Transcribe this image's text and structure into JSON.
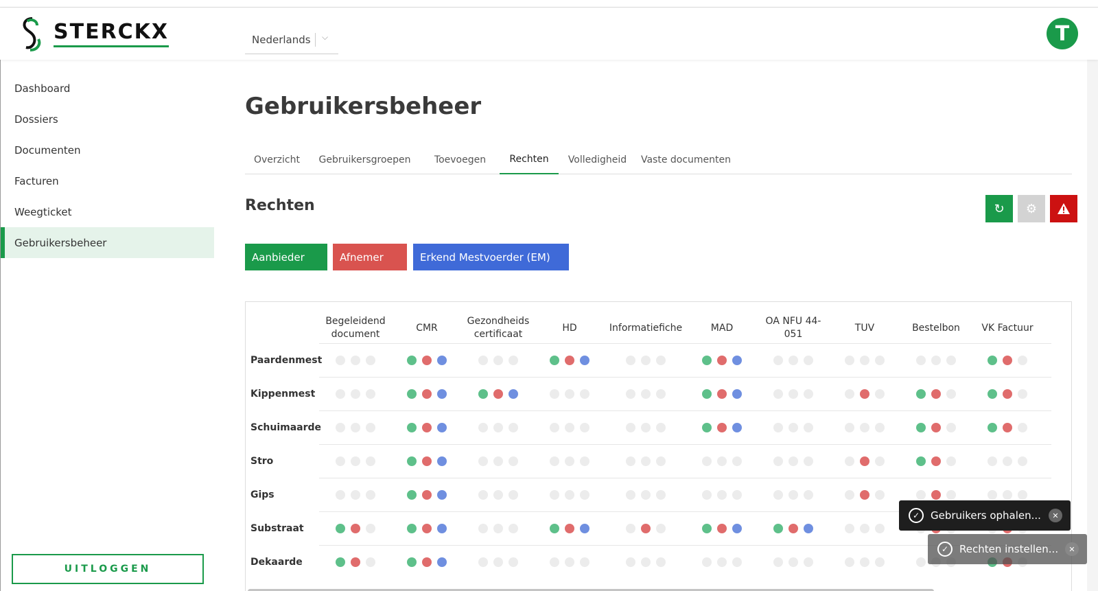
{
  "app": {
    "logo_text": "STERCKX",
    "language": "Nederlands",
    "avatar_letter": "T"
  },
  "sidebar": {
    "items": [
      {
        "label": "Dashboard"
      },
      {
        "label": "Dossiers"
      },
      {
        "label": "Documenten"
      },
      {
        "label": "Facturen"
      },
      {
        "label": "Weegticket"
      },
      {
        "label": "Gebruikersbeheer",
        "active": true
      }
    ],
    "logout_label": "UITLOGGEN"
  },
  "page": {
    "title": "Gebruikersbeheer"
  },
  "tabs": [
    {
      "label": "Overzicht"
    },
    {
      "label": "Gebruikersgroepen"
    },
    {
      "label": "Toevoegen"
    },
    {
      "label": "Rechten",
      "active": true
    },
    {
      "label": "Volledigheid"
    },
    {
      "label": "Vaste documenten"
    }
  ],
  "section": {
    "title": "Rechten"
  },
  "toolbar": {
    "refresh_icon": "refresh-icon",
    "settings_icon": "gear-icon",
    "warning_icon": "warning-icon"
  },
  "roles": [
    {
      "label": "Aanbieder",
      "color": "#1a9a4a"
    },
    {
      "label": "Afnemer",
      "color": "#d9534f"
    },
    {
      "label": "Erkend Mestvoerder (EM)",
      "color": "#3f6ad8"
    }
  ],
  "colors": {
    "green": "#5ec08a",
    "red": "#e06c6c",
    "blue": "#6f8fe0",
    "off": "#ececec",
    "accent": "#1a9a4a"
  },
  "table": {
    "columns": [
      {
        "line1": "Begeleidend",
        "line2": "document"
      },
      {
        "line1": "CMR",
        "line2": ""
      },
      {
        "line1": "Gezondheids",
        "line2": "certificaat"
      },
      {
        "line1": "HD",
        "line2": ""
      },
      {
        "line1": "Informatiefiche",
        "line2": ""
      },
      {
        "line1": "MAD",
        "line2": ""
      },
      {
        "line1": "OA NFU 44-",
        "line2": "051"
      },
      {
        "line1": "TUV",
        "line2": ""
      },
      {
        "line1": "Bestelbon",
        "line2": ""
      },
      {
        "line1": "VK Factuur",
        "line2": ""
      }
    ],
    "rows": [
      {
        "label": "Paardenmest",
        "cells": [
          "000",
          "111",
          "000",
          "111",
          "000",
          "111",
          "000",
          "000",
          "000",
          "110"
        ]
      },
      {
        "label": "Kippenmest",
        "cells": [
          "000",
          "111",
          "111",
          "000",
          "000",
          "111",
          "000",
          "010",
          "110",
          "110"
        ]
      },
      {
        "label": "Schuimaarde",
        "cells": [
          "000",
          "111",
          "000",
          "000",
          "000",
          "111",
          "000",
          "000",
          "110",
          "110"
        ]
      },
      {
        "label": "Stro",
        "cells": [
          "000",
          "111",
          "000",
          "000",
          "000",
          "000",
          "000",
          "010",
          "110",
          "000"
        ]
      },
      {
        "label": "Gips",
        "cells": [
          "000",
          "111",
          "000",
          "000",
          "000",
          "000",
          "000",
          "010",
          "010",
          "000"
        ]
      },
      {
        "label": "Substraat",
        "cells": [
          "110",
          "111",
          "000",
          "111",
          "010",
          "111",
          "111",
          "000",
          "010",
          "010"
        ]
      },
      {
        "label": "Dekaarde",
        "cells": [
          "110",
          "111",
          "000",
          "000",
          "000",
          "000",
          "000",
          "000",
          "000",
          "110"
        ]
      }
    ]
  },
  "toasts": [
    {
      "text": "Gebruikers ophalen..."
    },
    {
      "text": "Rechten instellen..."
    }
  ]
}
